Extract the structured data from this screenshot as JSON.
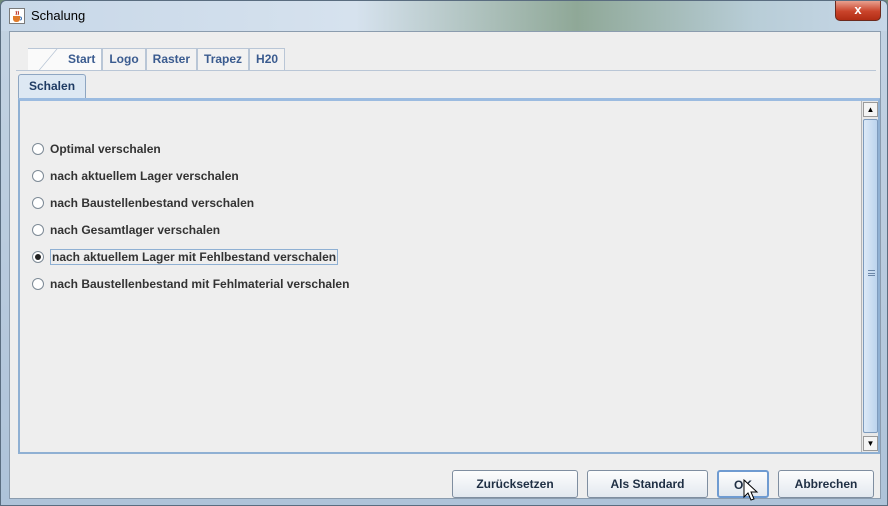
{
  "window": {
    "title": "Schalung",
    "close_symbol": "x",
    "app_icon": "java-cup-icon"
  },
  "outer_tabs": [
    "Start",
    "Logo",
    "Raster",
    "Trapez",
    "H20"
  ],
  "inner_tab": "Schalen",
  "options": [
    {
      "label": "Optimal verschalen",
      "selected": false
    },
    {
      "label": "nach aktuellem Lager verschalen",
      "selected": false
    },
    {
      "label": "nach Baustellenbestand verschalen",
      "selected": false
    },
    {
      "label": "nach Gesamtlager verschalen",
      "selected": false
    },
    {
      "label": "nach aktuellem Lager mit Fehlbestand verschalen",
      "selected": true
    },
    {
      "label": "nach Baustellenbestand mit Fehlmaterial verschalen",
      "selected": false
    }
  ],
  "buttons": {
    "reset": "Zurücksetzen",
    "default": "Als Standard",
    "ok": "OK",
    "cancel": "Abbrechen"
  },
  "scrollbar": {
    "up_symbol": "▲",
    "down_symbol": "▼"
  }
}
